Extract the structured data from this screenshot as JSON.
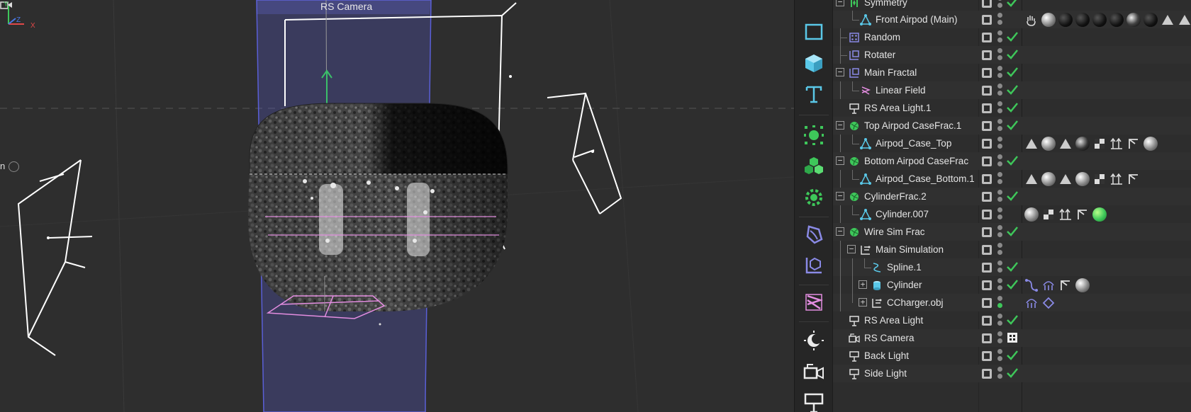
{
  "viewport": {
    "camera_label": "RS Camera",
    "left_label": "n",
    "axes": {
      "y": "Y",
      "z": "Z",
      "x": "X"
    }
  },
  "colors": {
    "accent_green": "#3ec75a",
    "selection_blue": "#5a5fd6",
    "wire_white": "#ffffff",
    "gizmo_green": "#3bbf6a",
    "plane_pink": "#e38de0",
    "cyan_icon": "#5ac8e8"
  },
  "toolbar": {
    "tools": [
      "cube-outline-icon",
      "cube-icon",
      "text-icon",
      "cloner-icon",
      "mograph-icon",
      "effector-icon",
      "deformer-icon",
      "spline-icon",
      "field-icon",
      "light-icon",
      "camera-icon",
      "floor-icon"
    ]
  },
  "objects": [
    {
      "name": "Symmetry",
      "icon": "symmetry-icon",
      "expander": "minus",
      "check": true
    },
    {
      "name": "Front Airpod (Main)",
      "icon": "polygon-object-icon",
      "check": false
    },
    {
      "name": "Random",
      "icon": "random-effector-icon",
      "check": true
    },
    {
      "name": "Rotater",
      "icon": "rotater-icon",
      "check": true
    },
    {
      "name": "Main Fractal",
      "icon": "fracture-icon",
      "expander": "minus",
      "check": true
    },
    {
      "name": "Linear Field",
      "icon": "linear-field-icon",
      "check": true
    },
    {
      "name": "RS Area Light.1",
      "icon": "area-light-icon",
      "check": true
    },
    {
      "name": "Top Airpod CaseFrac.1",
      "icon": "voronoi-fracture-icon",
      "expander": "minus",
      "check": true
    },
    {
      "name": "Airpod_Case_Top",
      "icon": "polygon-object-icon",
      "check": false
    },
    {
      "name": "Bottom Airpod CaseFrac",
      "icon": "voronoi-fracture-icon",
      "expander": "minus",
      "check": true
    },
    {
      "name": "Airpod_Case_Bottom.1",
      "icon": "polygon-object-icon",
      "check": false
    },
    {
      "name": "CylinderFrac.2",
      "icon": "voronoi-fracture-icon",
      "expander": "minus",
      "check": true
    },
    {
      "name": "Cylinder.007",
      "icon": "polygon-object-icon",
      "check": false
    },
    {
      "name": "Wire Sim Frac",
      "icon": "voronoi-fracture-icon",
      "expander": "minus",
      "check": true
    },
    {
      "name": "Main Simulation",
      "icon": "null-spline-icon",
      "expander": "minus",
      "check": false
    },
    {
      "name": "Spline.1",
      "icon": "spline-icon",
      "check": true
    },
    {
      "name": "Cylinder",
      "icon": "cylinder-icon",
      "expander": "plus",
      "check": true
    },
    {
      "name": "CCharger.obj",
      "icon": "null-spline-icon",
      "expander": "plus",
      "check": false
    },
    {
      "name": "RS Area Light",
      "icon": "area-light-icon",
      "check": true
    },
    {
      "name": "RS Camera",
      "icon": "camera-icon",
      "check": false
    },
    {
      "name": "Back Light",
      "icon": "area-light-icon",
      "check": true
    },
    {
      "name": "Side Light",
      "icon": "area-light-icon",
      "check": true
    }
  ]
}
